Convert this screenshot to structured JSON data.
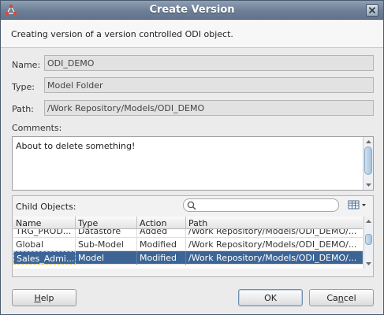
{
  "window": {
    "title": "Create Version"
  },
  "header": {
    "description": "Creating version of a version controlled ODI object."
  },
  "form": {
    "name_label": "Name:",
    "name_value": "ODI_DEMO",
    "type_label": "Type:",
    "type_value": "Model Folder",
    "path_label": "Path:",
    "path_value": "/Work Repository/Models/ODI_DEMO",
    "comments_label": "Comments:",
    "comments_value": "About to delete something!"
  },
  "child_objects": {
    "label": "Child Objects:",
    "search_placeholder": "",
    "columns": [
      "Name",
      "Type",
      "Action",
      "Path"
    ],
    "rows": [
      {
        "name": "TRG_PROD...",
        "type": "Datastore",
        "action": "Added",
        "path": "/Work Repository/Models/ODI_DEMO/..."
      },
      {
        "name": "Global",
        "type": "Sub-Model",
        "action": "Modified",
        "path": "/Work Repository/Models/ODI_DEMO/..."
      },
      {
        "name": "Sales_Admi...",
        "type": "Model",
        "action": "Modified",
        "path": "/Work Repository/Models/ODI_DEMO/..."
      }
    ],
    "selected_row": 2
  },
  "buttons": {
    "help_mnemonic": "H",
    "help_rest": "elp",
    "ok": "OK",
    "cancel_pre": "Ca",
    "cancel_mnemonic": "n",
    "cancel_rest": "cel"
  },
  "colors": {
    "titlebar": "#6d7f96",
    "selection": "#3c6596"
  }
}
